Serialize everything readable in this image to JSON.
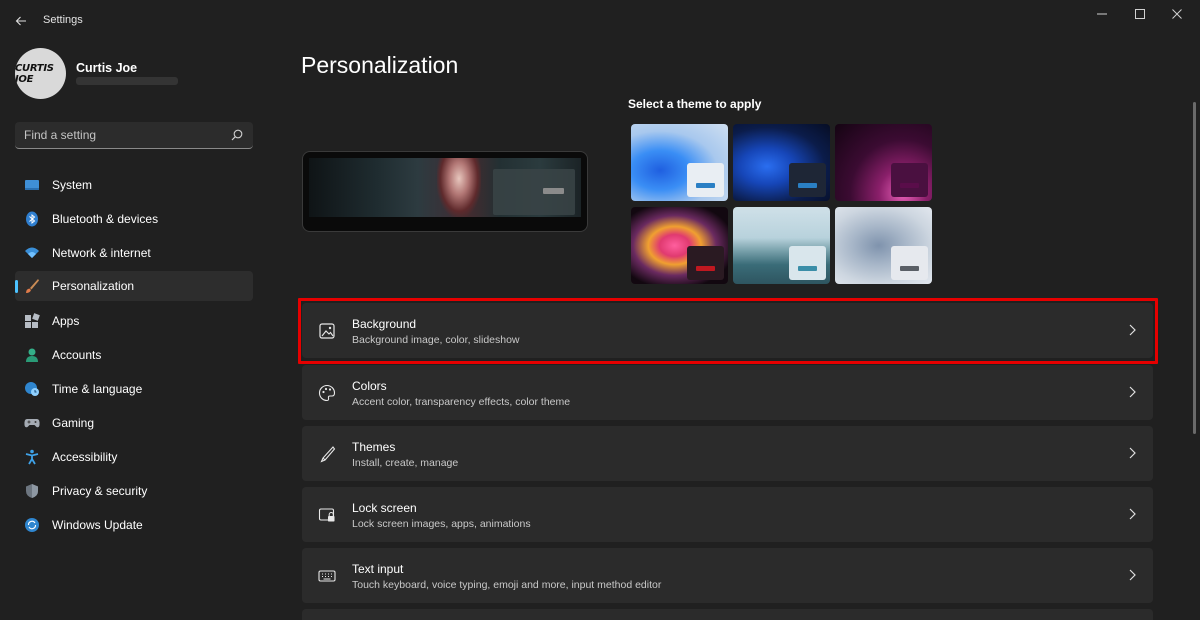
{
  "window": {
    "title": "Settings"
  },
  "user": {
    "name": "Curtis Joe",
    "avatar_text": "CURTIS JOE"
  },
  "search": {
    "placeholder": "Find a setting"
  },
  "sidebar": {
    "items": [
      {
        "label": "System",
        "icon": "monitor-icon"
      },
      {
        "label": "Bluetooth & devices",
        "icon": "bluetooth-icon"
      },
      {
        "label": "Network & internet",
        "icon": "wifi-icon"
      },
      {
        "label": "Personalization",
        "icon": "brush-icon",
        "selected": true
      },
      {
        "label": "Apps",
        "icon": "apps-icon"
      },
      {
        "label": "Accounts",
        "icon": "person-icon"
      },
      {
        "label": "Time & language",
        "icon": "globe-clock-icon"
      },
      {
        "label": "Gaming",
        "icon": "gamepad-icon"
      },
      {
        "label": "Accessibility",
        "icon": "accessibility-icon"
      },
      {
        "label": "Privacy & security",
        "icon": "shield-icon"
      },
      {
        "label": "Windows Update",
        "icon": "update-icon"
      }
    ]
  },
  "main": {
    "title": "Personalization",
    "themes_label": "Select a theme to apply",
    "themes": [
      {
        "name": "windows-light",
        "bar_color": "#2a7fc4"
      },
      {
        "name": "windows-dark",
        "bar_color": "#2a7fc4"
      },
      {
        "name": "glow",
        "bar_color": "#5a0d4a"
      },
      {
        "name": "captured-motion",
        "bar_color": "#c01820"
      },
      {
        "name": "sunrise",
        "bar_color": "#3a8ea8"
      },
      {
        "name": "flow",
        "bar_color": "#5a5f66"
      }
    ],
    "cards": [
      {
        "title": "Background",
        "subtitle": "Background image, color, slideshow",
        "icon": "image-icon",
        "highlighted": true
      },
      {
        "title": "Colors",
        "subtitle": "Accent color, transparency effects, color theme",
        "icon": "palette-icon"
      },
      {
        "title": "Themes",
        "subtitle": "Install, create, manage",
        "icon": "pen-icon"
      },
      {
        "title": "Lock screen",
        "subtitle": "Lock screen images, apps, animations",
        "icon": "lock-screen-icon"
      },
      {
        "title": "Text input",
        "subtitle": "Touch keyboard, voice typing, emoji and more, input method editor",
        "icon": "keyboard-icon"
      }
    ]
  },
  "colors": {
    "accent": "#4cc2ff",
    "highlight_box": "#e60000"
  }
}
